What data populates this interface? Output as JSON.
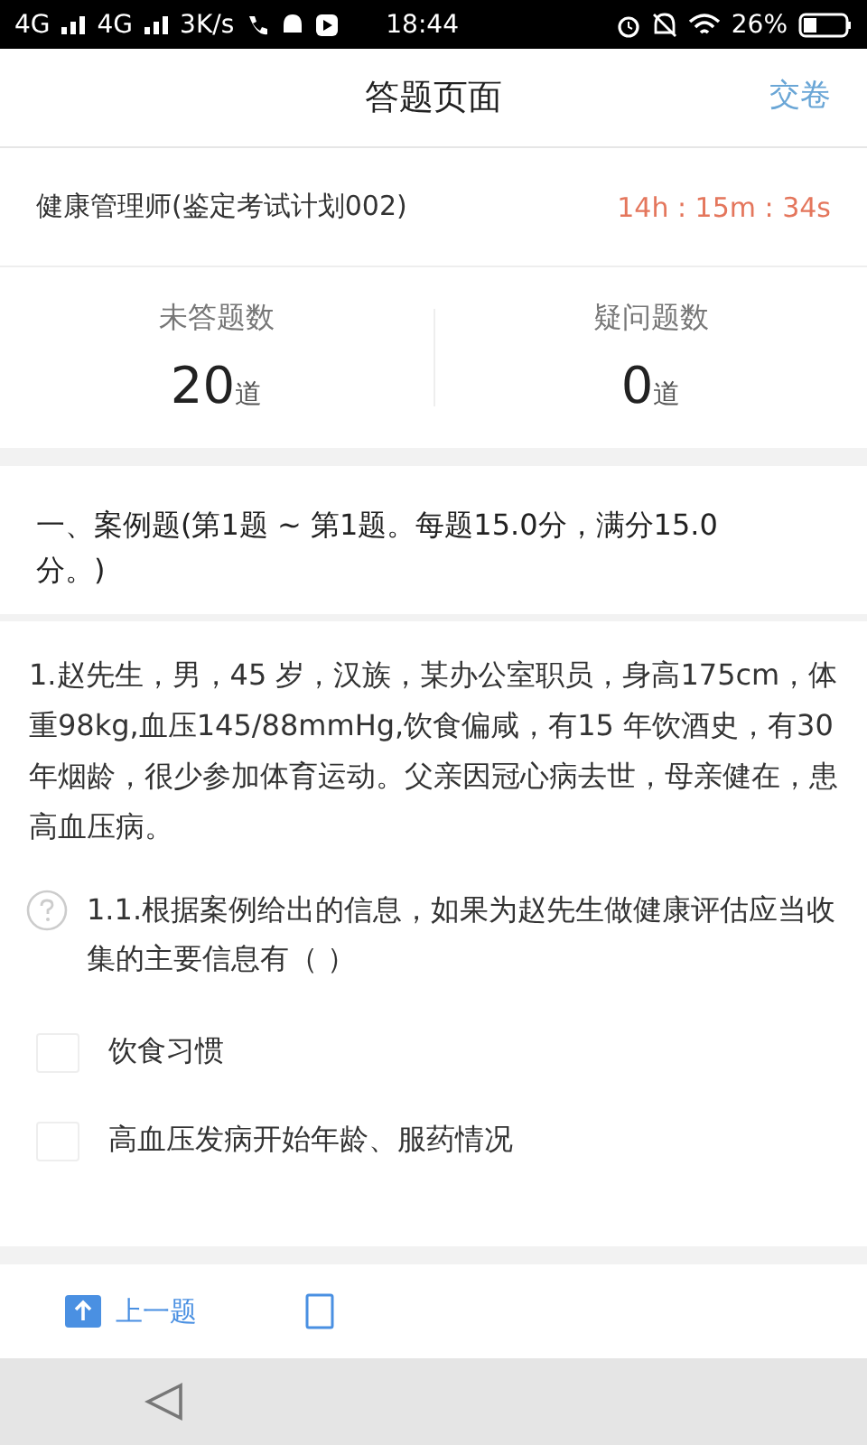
{
  "status_bar": {
    "network_1": "4G",
    "network_2": "4G",
    "speed": "3K/s",
    "time": "18:44",
    "battery": "26%"
  },
  "header": {
    "title": "答题页面",
    "action": "交卷"
  },
  "exam": {
    "name": "健康管理师(鉴定考试计划002)",
    "timer": "14h : 15m : 34s"
  },
  "stats": [
    {
      "label": "未答题数",
      "count": "20",
      "unit": "道"
    },
    {
      "label": "疑问题数",
      "count": "0",
      "unit": "道"
    }
  ],
  "section": {
    "heading": "一、案例题(第1题 ~ 第1题。每题15.0分，满分15.0分。)"
  },
  "case_text": "1.赵先生，男，45 岁，汉族，某办公室职员，身高175cm，体重98kg,血压145/88mmHg,饮食偏咸，有15 年饮酒史，有30 年烟龄，很少参加体育运动。父亲因冠心病去世，母亲健在，患高血压病。",
  "question": {
    "text": "1.1.根据案例给出的信息，如果为赵先生做健康评估应当收集的主要信息有（ ）",
    "doubt_marked": false
  },
  "options": [
    {
      "label": "饮食习惯",
      "checked": false
    },
    {
      "label": "高血压发病开始年龄、服药情况",
      "checked": false
    }
  ],
  "bottom_bar": {
    "prev": "上一题"
  }
}
